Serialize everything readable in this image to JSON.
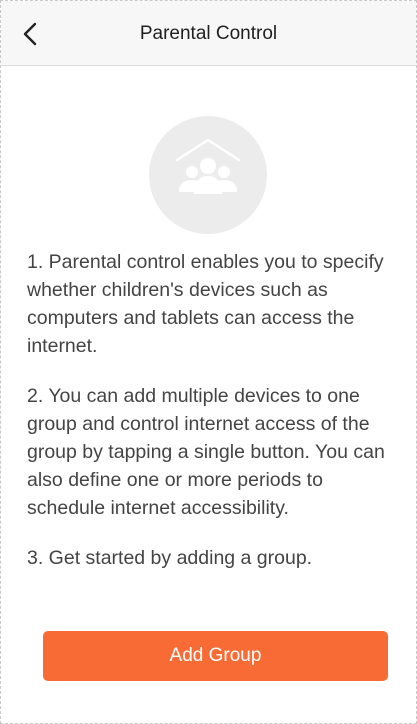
{
  "navbar": {
    "title": "Parental Control",
    "back_icon": "chevron-left-icon"
  },
  "hero": {
    "icon": "family-group-icon"
  },
  "description": {
    "paragraphs": [
      "1. Parental control enables you to specify whether children's devices such as computers and tablets can access the internet.",
      "2. You can add multiple devices to one group and control internet access of the group by tapping a single button. You can also define one or more periods to schedule internet accessibility.",
      "3. Get started by adding a group."
    ]
  },
  "actions": {
    "add_group_label": "Add Group"
  },
  "colors": {
    "accent": "#f86b35",
    "navbar_bg": "#f7f7f7",
    "hero_bg": "#ececec",
    "text": "#444444"
  }
}
